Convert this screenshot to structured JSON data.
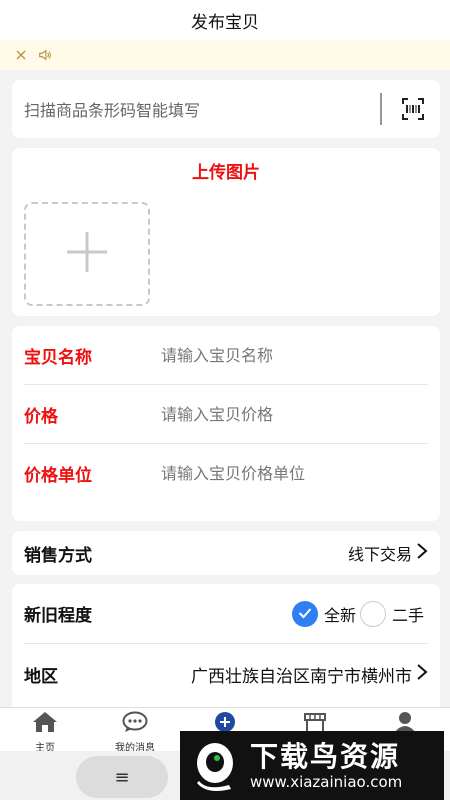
{
  "header": {
    "title": "发布宝贝"
  },
  "scan": {
    "placeholder": "扫描商品条形码智能填写"
  },
  "upload": {
    "title": "上传图片"
  },
  "form": {
    "fields": [
      {
        "label": "宝贝名称",
        "placeholder": "请输入宝贝名称"
      },
      {
        "label": "价格",
        "placeholder": "请输入宝贝价格"
      },
      {
        "label": "价格单位",
        "placeholder": "请输入宝贝价格单位"
      }
    ]
  },
  "sale": {
    "label": "销售方式",
    "value": "线下交易"
  },
  "condition": {
    "label": "新旧程度",
    "options": [
      {
        "label": "全新",
        "selected": true
      },
      {
        "label": "二手",
        "selected": false
      }
    ]
  },
  "region": {
    "label": "地区",
    "value": "广西壮族自治区南宁市横州市"
  },
  "tabbar": {
    "items": [
      {
        "label": "主页"
      },
      {
        "label": "我的消息"
      },
      {
        "label": ""
      },
      {
        "label": ""
      },
      {
        "label": ""
      }
    ]
  },
  "navbar": {
    "menu_glyph": "≡"
  },
  "watermark": {
    "main": "下载鸟资源",
    "sub": "www.xiazainiao.com"
  },
  "colors": {
    "accent_red": "#ee1111",
    "radio_blue": "#2f7ff2",
    "notice_bg": "#fffbe8",
    "tab_icon": "#555555",
    "publish_blue": "#1f4aa0"
  },
  "icons": [
    "close-icon",
    "speaker-icon",
    "scan-icon",
    "plus-icon",
    "chevron-right-icon",
    "check-icon",
    "home-icon",
    "chat-icon",
    "publish-icon",
    "shop-icon",
    "profile-icon"
  ]
}
